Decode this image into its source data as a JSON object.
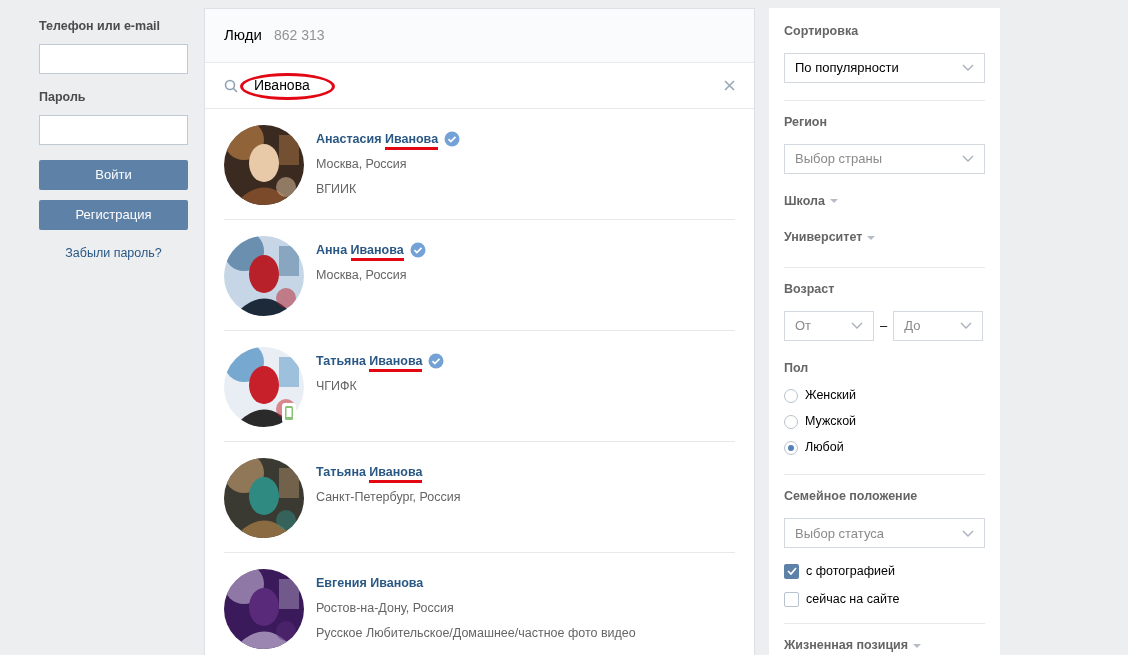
{
  "login": {
    "login_label": "Телефон или e-mail",
    "password_label": "Пароль",
    "login_button": "Войти",
    "register_button": "Регистрация",
    "forgot_link": "Забыли пароль?"
  },
  "header": {
    "title": "Люди",
    "count": "862 313"
  },
  "search": {
    "value": "Иванова",
    "circled": true
  },
  "people": [
    {
      "first": "Анастасия",
      "last": "Иванова",
      "verified": true,
      "underlined": true,
      "mobile": false,
      "lines": [
        "Москва, Россия",
        "ВГИИК"
      ],
      "kind": "picture"
    },
    {
      "first": "Анна",
      "last": "Иванова",
      "verified": true,
      "underlined": true,
      "mobile": false,
      "lines": [
        "Москва, Россия"
      ],
      "kind": "picture"
    },
    {
      "first": "Татьяна",
      "last": "Иванова",
      "verified": true,
      "underlined": true,
      "mobile": true,
      "lines": [
        "ЧГИФК"
      ],
      "kind": "picture"
    },
    {
      "first": "Татьяна",
      "last": "Иванова",
      "verified": false,
      "underlined": true,
      "mobile": false,
      "lines": [
        "Санкт-Петербург, Россия"
      ],
      "kind": "picture"
    },
    {
      "first": "Евгения",
      "last": "Иванова",
      "verified": false,
      "underlined": false,
      "mobile": false,
      "lines": [
        "Ростов-на-Дону, Россия",
        "Русское Любительское/Домашнее/частное фото видео"
      ],
      "kind": "picture"
    }
  ],
  "filters": {
    "sort_label": "Сортировка",
    "sort_value": "По популярности",
    "region_label": "Регион",
    "region_placeholder": "Выбор страны",
    "school": "Школа",
    "university": "Университет",
    "age_label": "Возраст",
    "age_from": "От",
    "age_dash": "–",
    "age_to": "До",
    "sex_label": "Пол",
    "sex_options": [
      {
        "label": "Женский",
        "selected": false
      },
      {
        "label": "Мужской",
        "selected": false
      },
      {
        "label": "Любой",
        "selected": true
      }
    ],
    "family_label": "Семейное положение",
    "family_placeholder": "Выбор статуса",
    "checkboxes": [
      {
        "label": "с фотографией",
        "checked": true
      },
      {
        "label": "сейчас на сайте",
        "checked": false
      }
    ],
    "life_position": "Жизненная позиция"
  }
}
